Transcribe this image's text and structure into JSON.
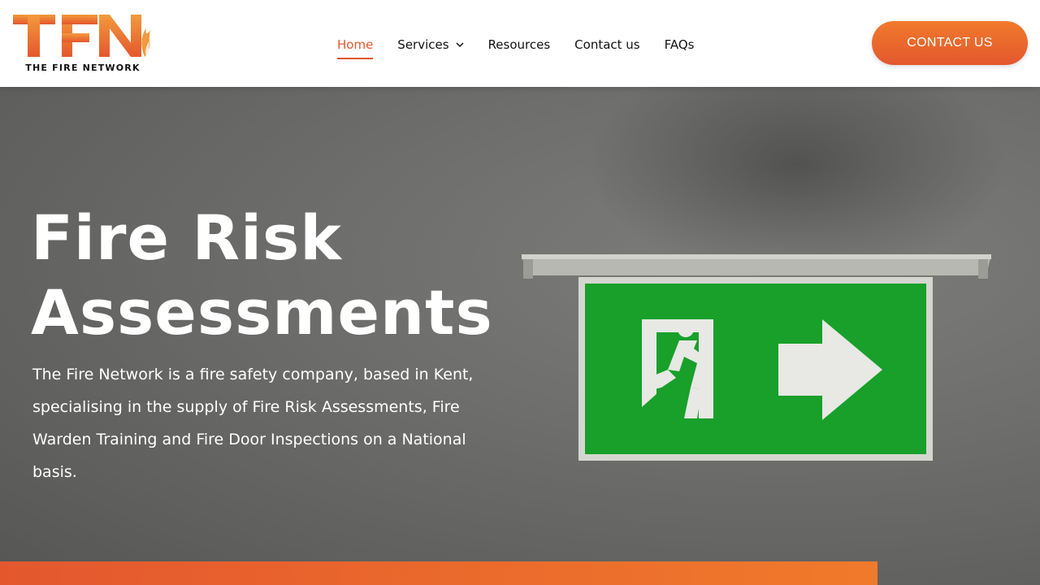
{
  "brand": {
    "logo_letters": "TFN",
    "tagline": "THE FIRE NETWORK",
    "colors": {
      "orange": "#f07a2b",
      "orange_dark": "#e4572e",
      "text": "#111111"
    }
  },
  "nav": {
    "items": [
      {
        "label": "Home",
        "active": true
      },
      {
        "label": "Services",
        "has_dropdown": true
      },
      {
        "label": "Resources"
      },
      {
        "label": "Contact us"
      },
      {
        "label": "FAQs"
      }
    ]
  },
  "header": {
    "contact_button": "CONTACT US"
  },
  "hero": {
    "title_line1": "Fire Risk",
    "title_line2": "Assessments",
    "text": "The Fire Network is a fire safety company, based in Kent, specialising in the supply of Fire Risk Assessments, Fire Warden Training and Fire Door Inspections on a National basis.",
    "image": "green-exit-sign-icon"
  }
}
